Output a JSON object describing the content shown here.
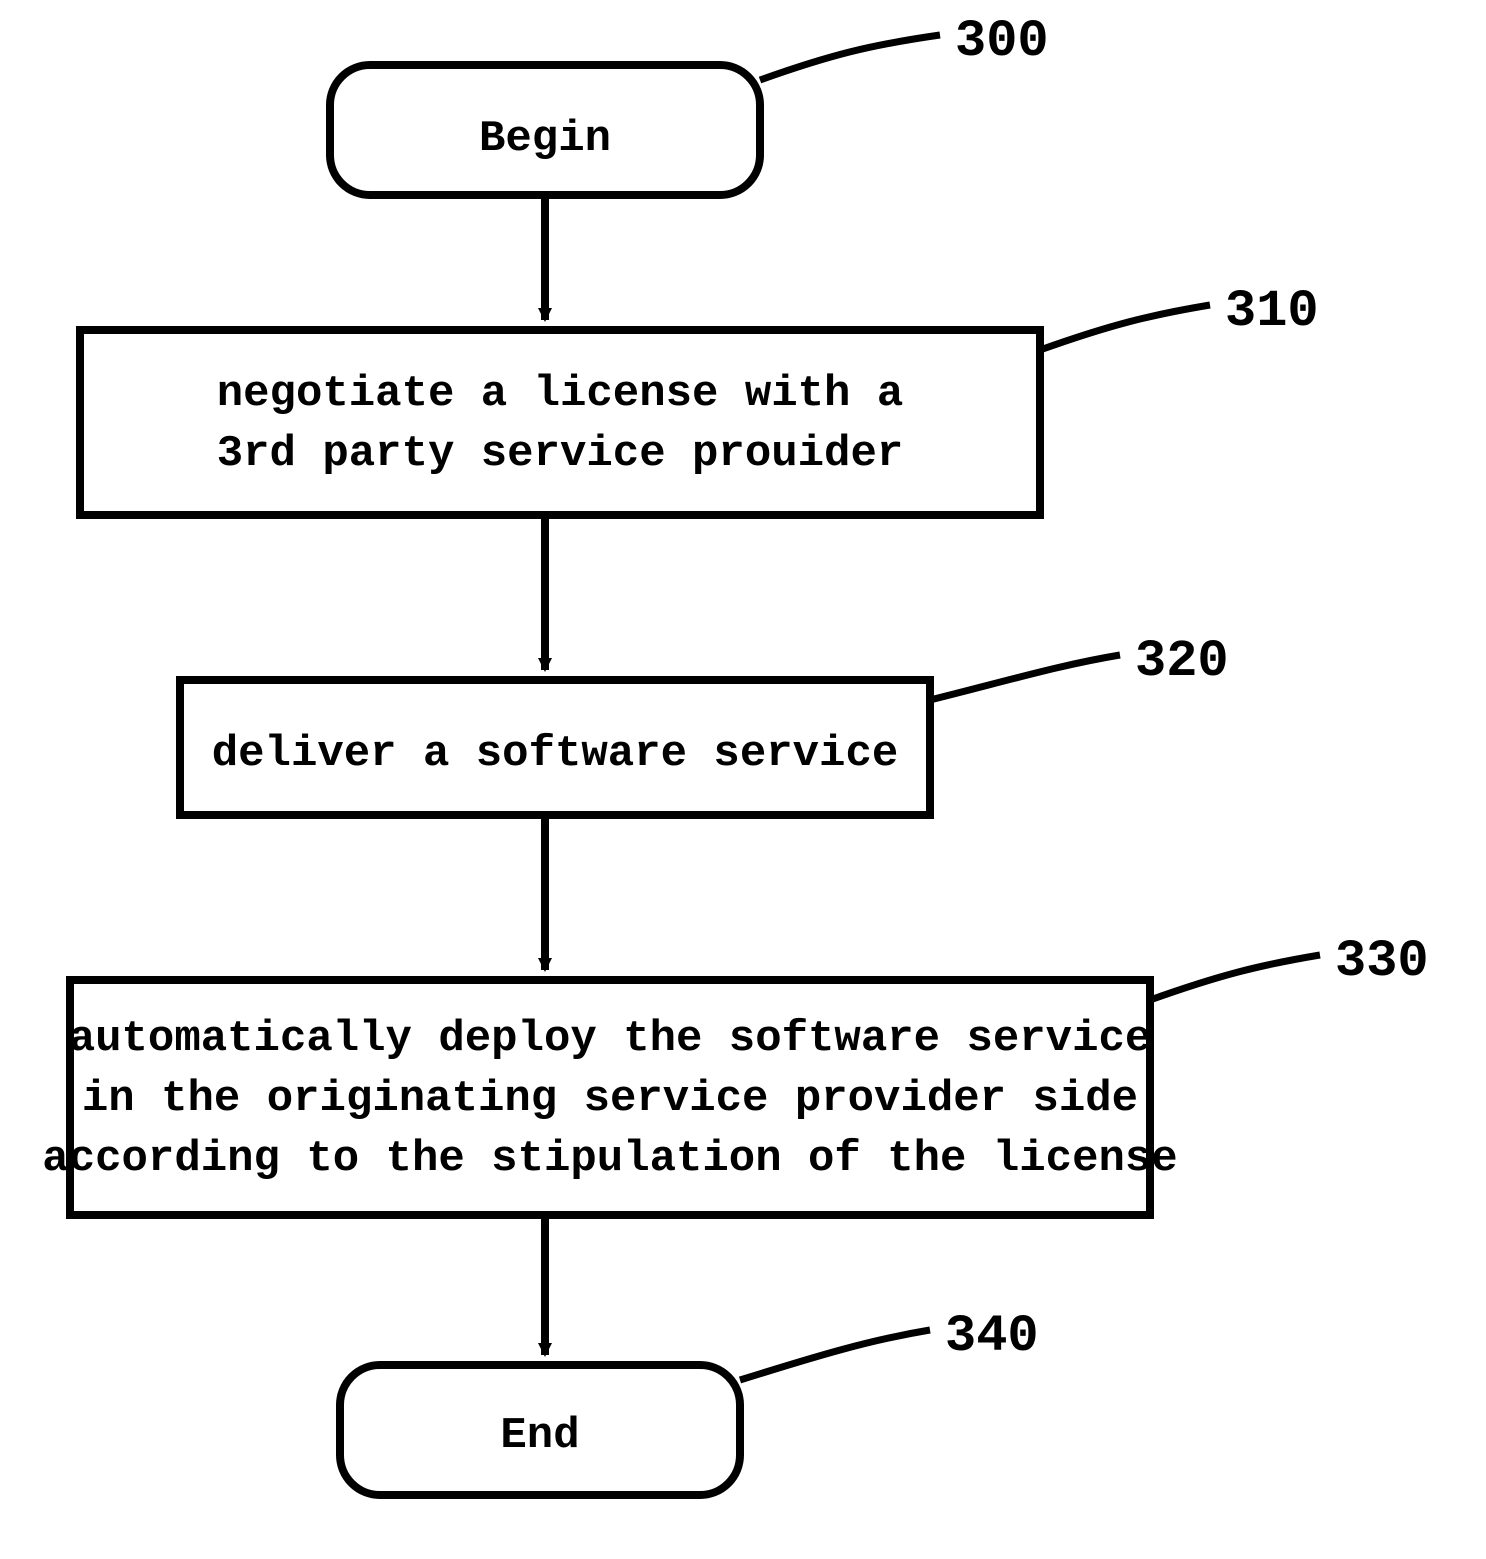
{
  "nodes": {
    "begin": {
      "label": "300",
      "text": "Begin"
    },
    "step310": {
      "label": "310",
      "line1": "negotiate a license with a",
      "line2": "3rd party service prouider"
    },
    "step320": {
      "label": "320",
      "line1": "deliver a software service"
    },
    "step330": {
      "label": "330",
      "line1": "automatically deploy the software service",
      "line2": "in the originating service provider side",
      "line3": "according to the stipulation of the license"
    },
    "end": {
      "label": "340",
      "text": "End"
    }
  }
}
